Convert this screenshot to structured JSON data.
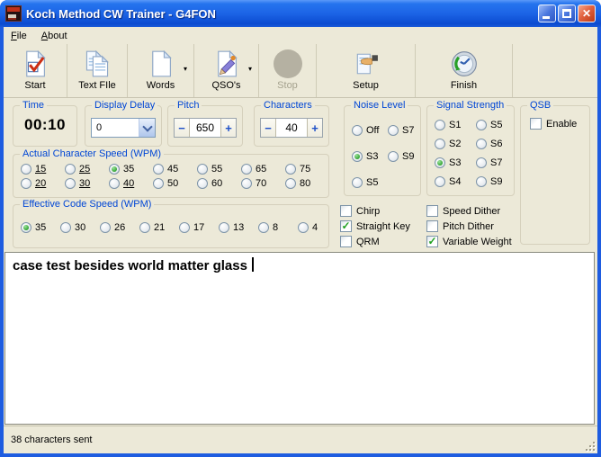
{
  "window": {
    "title": "Koch Method CW Trainer - G4FON",
    "status": "38 characters sent"
  },
  "menu": {
    "file": {
      "accel": "F",
      "rest": "ile"
    },
    "about": {
      "accel": "A",
      "rest": "bout"
    }
  },
  "toolbar": {
    "start": "Start",
    "text_file": "Text FIle",
    "words": "Words",
    "qsos": "QSO's",
    "stop": "Stop",
    "setup": "Setup",
    "finish": "Finish"
  },
  "controls": {
    "time": {
      "label": "Time",
      "value": "00:10"
    },
    "display_delay": {
      "label": "Display Delay",
      "value": "0"
    },
    "pitch": {
      "label": "Pitch",
      "value": "650"
    },
    "characters": {
      "label": "Characters",
      "value": "40"
    }
  },
  "noise_level": {
    "label": "Noise Level",
    "col1": [
      {
        "label": "Off",
        "selected": false
      },
      {
        "label": "S3",
        "selected": true
      },
      {
        "label": "S5",
        "selected": false
      }
    ],
    "col2": [
      {
        "label": "S7",
        "selected": false
      },
      {
        "label": "S9",
        "selected": false
      }
    ]
  },
  "signal_strength": {
    "label": "Signal Strength",
    "col1": [
      {
        "label": "S1",
        "selected": false
      },
      {
        "label": "S2",
        "selected": false
      },
      {
        "label": "S3",
        "selected": true
      },
      {
        "label": "S4",
        "selected": false
      }
    ],
    "col2": [
      {
        "label": "S5",
        "selected": false
      },
      {
        "label": "S6",
        "selected": false
      },
      {
        "label": "S7",
        "selected": false
      },
      {
        "label": "S9",
        "selected": false
      }
    ]
  },
  "qsb": {
    "label": "QSB",
    "enable": {
      "label": "Enable",
      "checked": false
    }
  },
  "actual_speed": {
    "label": "Actual Character Speed (WPM)",
    "cols": [
      [
        {
          "label": "15",
          "underline": true,
          "selected": false
        },
        {
          "label": "20",
          "underline": true,
          "selected": false
        }
      ],
      [
        {
          "label": "25",
          "underline": true,
          "selected": false
        },
        {
          "label": "30",
          "underline": true,
          "selected": false
        }
      ],
      [
        {
          "label": "35",
          "underline": false,
          "selected": true
        },
        {
          "label": "40",
          "underline": true,
          "selected": false
        }
      ],
      [
        {
          "label": "45",
          "underline": false,
          "selected": false
        },
        {
          "label": "50",
          "underline": false,
          "selected": false
        }
      ],
      [
        {
          "label": "55",
          "underline": false,
          "selected": false
        },
        {
          "label": "60",
          "underline": false,
          "selected": false
        }
      ],
      [
        {
          "label": "65",
          "underline": false,
          "selected": false
        },
        {
          "label": "70",
          "underline": false,
          "selected": false
        }
      ],
      [
        {
          "label": "75",
          "underline": false,
          "selected": false
        },
        {
          "label": "80",
          "underline": false,
          "selected": false
        }
      ]
    ]
  },
  "effective_speed": {
    "label": "Effective Code Speed (WPM)",
    "options": [
      {
        "label": "35",
        "selected": true
      },
      {
        "label": "30",
        "selected": false
      },
      {
        "label": "26",
        "selected": false
      },
      {
        "label": "21",
        "selected": false
      },
      {
        "label": "17",
        "selected": false
      },
      {
        "label": "13",
        "selected": false
      },
      {
        "label": "8",
        "selected": false
      },
      {
        "label": "4",
        "selected": false
      }
    ]
  },
  "modifiers": {
    "col1": [
      {
        "label": "Chirp",
        "checked": false
      },
      {
        "label": "Straight Key",
        "checked": true
      },
      {
        "label": "QRM",
        "checked": false
      }
    ],
    "col2": [
      {
        "label": "Speed Dither",
        "checked": false
      },
      {
        "label": "Pitch Dither",
        "checked": false
      },
      {
        "label": "Variable Weight",
        "checked": true
      }
    ]
  },
  "output": {
    "text": "case test besides world matter glass"
  },
  "icons": {
    "checkmark": "✓",
    "dropdown_arrow": "▾",
    "minus": "−",
    "plus": "+",
    "close": "✕"
  }
}
